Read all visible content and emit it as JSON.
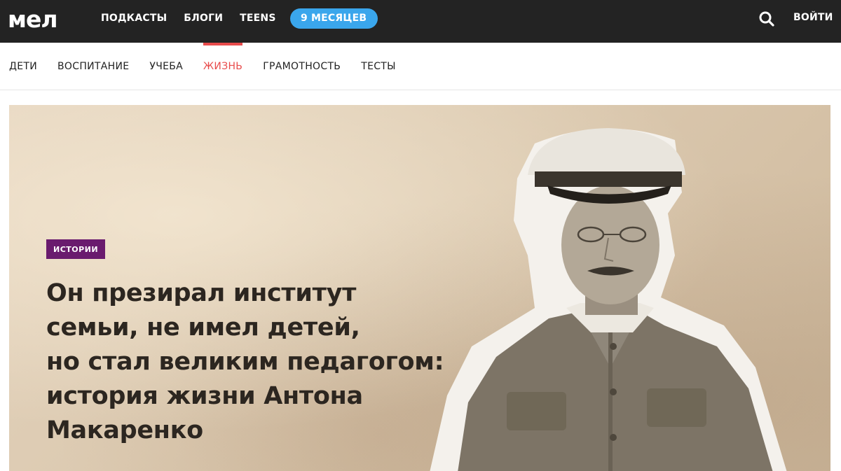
{
  "header": {
    "logo": "мел",
    "nav": [
      "ПОДКАСТЫ",
      "БЛОГИ",
      "TEENS"
    ],
    "promo": "9 МЕСЯЦЕВ",
    "login": "ВОЙТИ"
  },
  "sections": [
    "ДЕТИ",
    "ВОСПИТАНИЕ",
    "УЧЕБА",
    "ЖИЗНЬ",
    "ГРАМОТНОСТЬ",
    "ТЕСТЫ"
  ],
  "active_section": "ЖИЗНЬ",
  "article": {
    "tag": "ИСТОРИИ",
    "title_lines": [
      "Он презирал институт",
      "семьи, не имел детей,",
      "но стал великим педагогом:",
      "история жизни Антона",
      "Макаренко"
    ]
  },
  "colors": {
    "topbar": "#232323",
    "accent": "#e84b4b",
    "promo": "#3aa6ec",
    "tag": "#6a1b6e"
  }
}
